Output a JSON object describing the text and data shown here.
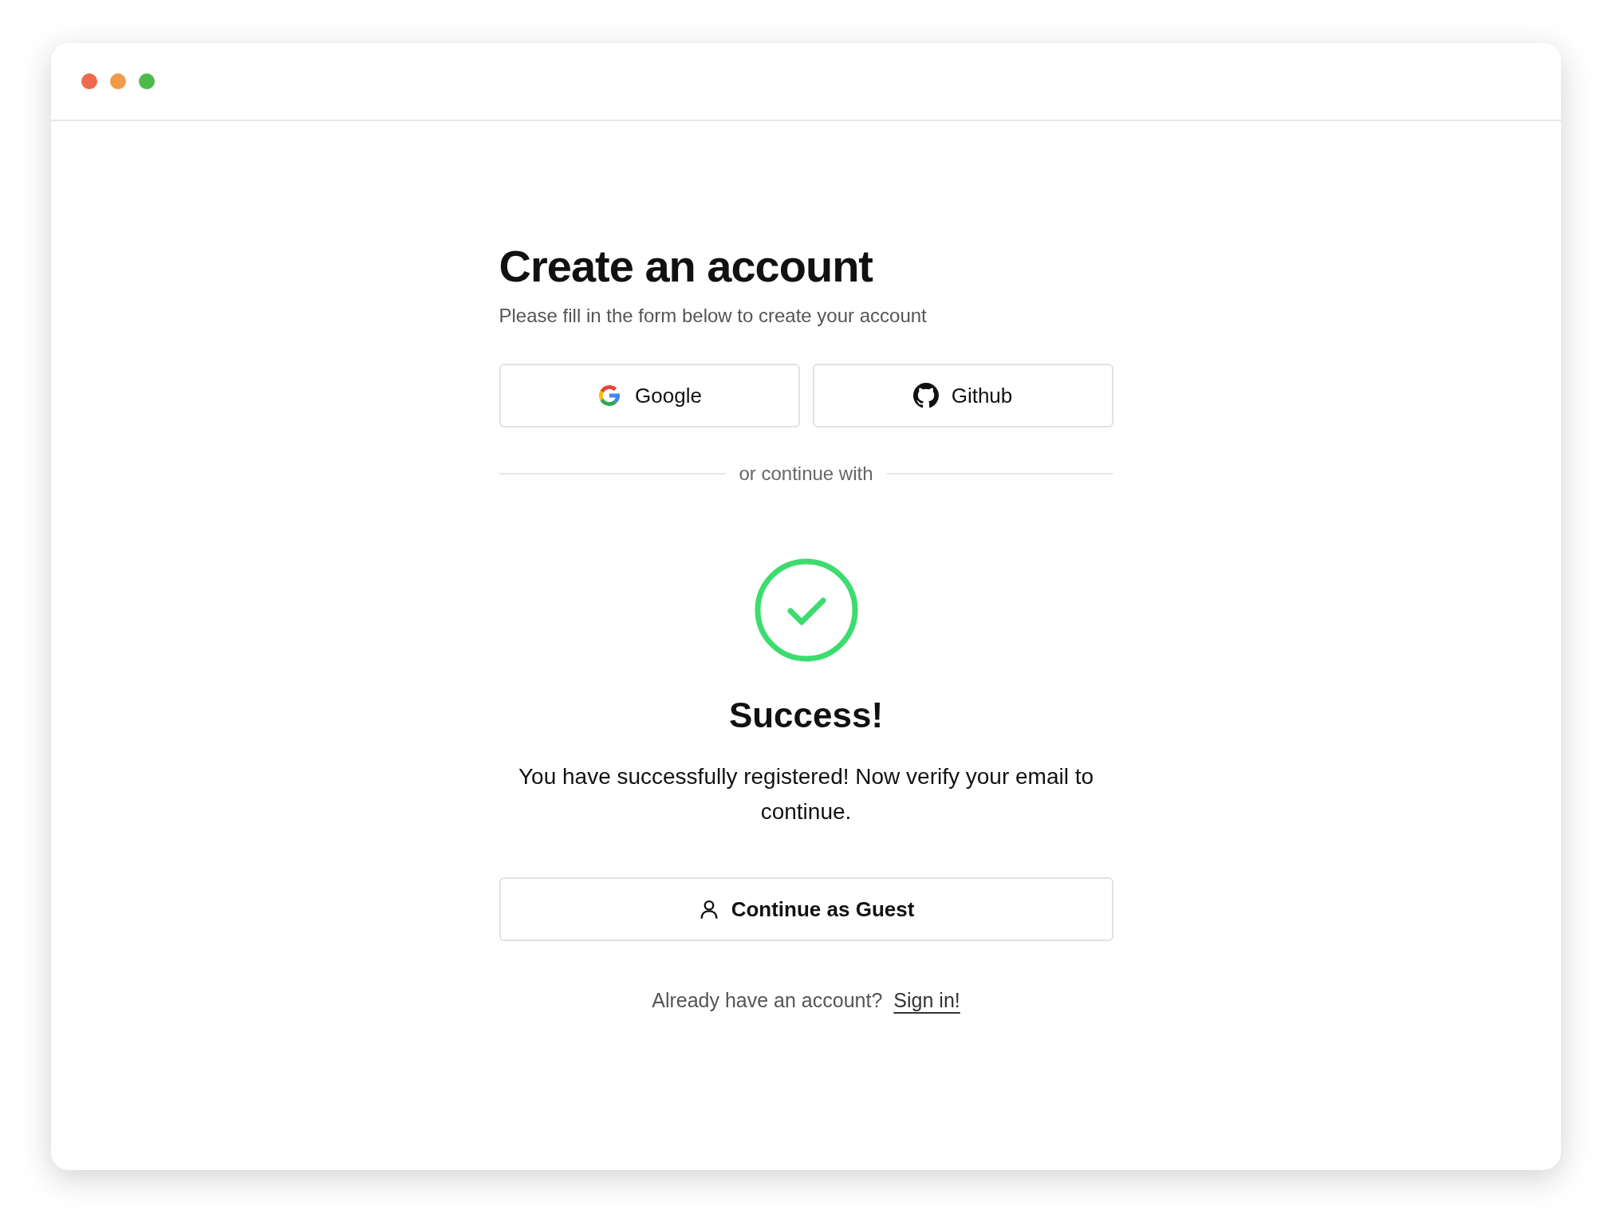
{
  "window": {
    "controls": [
      {
        "color": "#ee6a4c"
      },
      {
        "color": "#f2994a"
      },
      {
        "color": "#4cbb4c"
      }
    ]
  },
  "heading": "Create an account",
  "subtitle": "Please fill in the form below to create your account",
  "social_buttons": [
    {
      "label": "Google",
      "kind": "google"
    },
    {
      "label": "Github",
      "kind": "github"
    }
  ],
  "divider": "or continue with",
  "status": {
    "title": "Success!",
    "message": "You have successfully registered! Now verify your email to continue."
  },
  "guest_button": "Continue as Guest",
  "footer": {
    "text": "Already have an account?",
    "link": "Sign in!"
  }
}
